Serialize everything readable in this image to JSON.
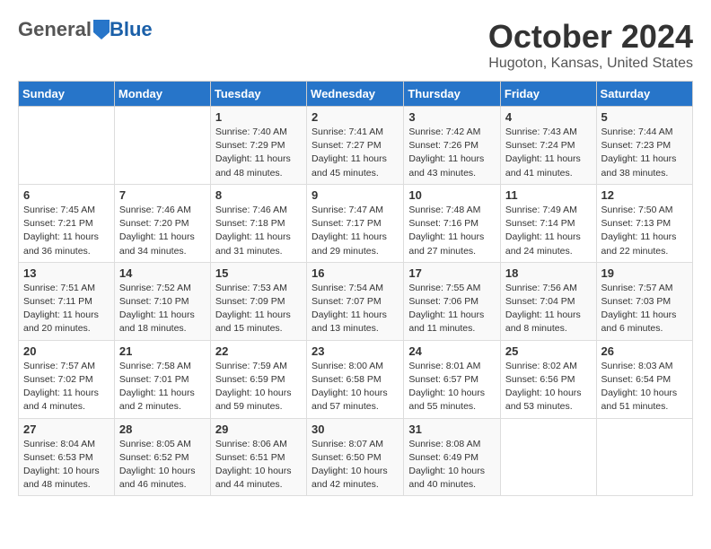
{
  "header": {
    "logo_general": "General",
    "logo_blue": "Blue",
    "month": "October 2024",
    "location": "Hugoton, Kansas, United States"
  },
  "days_of_week": [
    "Sunday",
    "Monday",
    "Tuesday",
    "Wednesday",
    "Thursday",
    "Friday",
    "Saturday"
  ],
  "weeks": [
    [
      {
        "day": "",
        "sunrise": "",
        "sunset": "",
        "daylight": ""
      },
      {
        "day": "",
        "sunrise": "",
        "sunset": "",
        "daylight": ""
      },
      {
        "day": "1",
        "sunrise": "Sunrise: 7:40 AM",
        "sunset": "Sunset: 7:29 PM",
        "daylight": "Daylight: 11 hours and 48 minutes."
      },
      {
        "day": "2",
        "sunrise": "Sunrise: 7:41 AM",
        "sunset": "Sunset: 7:27 PM",
        "daylight": "Daylight: 11 hours and 45 minutes."
      },
      {
        "day": "3",
        "sunrise": "Sunrise: 7:42 AM",
        "sunset": "Sunset: 7:26 PM",
        "daylight": "Daylight: 11 hours and 43 minutes."
      },
      {
        "day": "4",
        "sunrise": "Sunrise: 7:43 AM",
        "sunset": "Sunset: 7:24 PM",
        "daylight": "Daylight: 11 hours and 41 minutes."
      },
      {
        "day": "5",
        "sunrise": "Sunrise: 7:44 AM",
        "sunset": "Sunset: 7:23 PM",
        "daylight": "Daylight: 11 hours and 38 minutes."
      }
    ],
    [
      {
        "day": "6",
        "sunrise": "Sunrise: 7:45 AM",
        "sunset": "Sunset: 7:21 PM",
        "daylight": "Daylight: 11 hours and 36 minutes."
      },
      {
        "day": "7",
        "sunrise": "Sunrise: 7:46 AM",
        "sunset": "Sunset: 7:20 PM",
        "daylight": "Daylight: 11 hours and 34 minutes."
      },
      {
        "day": "8",
        "sunrise": "Sunrise: 7:46 AM",
        "sunset": "Sunset: 7:18 PM",
        "daylight": "Daylight: 11 hours and 31 minutes."
      },
      {
        "day": "9",
        "sunrise": "Sunrise: 7:47 AM",
        "sunset": "Sunset: 7:17 PM",
        "daylight": "Daylight: 11 hours and 29 minutes."
      },
      {
        "day": "10",
        "sunrise": "Sunrise: 7:48 AM",
        "sunset": "Sunset: 7:16 PM",
        "daylight": "Daylight: 11 hours and 27 minutes."
      },
      {
        "day": "11",
        "sunrise": "Sunrise: 7:49 AM",
        "sunset": "Sunset: 7:14 PM",
        "daylight": "Daylight: 11 hours and 24 minutes."
      },
      {
        "day": "12",
        "sunrise": "Sunrise: 7:50 AM",
        "sunset": "Sunset: 7:13 PM",
        "daylight": "Daylight: 11 hours and 22 minutes."
      }
    ],
    [
      {
        "day": "13",
        "sunrise": "Sunrise: 7:51 AM",
        "sunset": "Sunset: 7:11 PM",
        "daylight": "Daylight: 11 hours and 20 minutes."
      },
      {
        "day": "14",
        "sunrise": "Sunrise: 7:52 AM",
        "sunset": "Sunset: 7:10 PM",
        "daylight": "Daylight: 11 hours and 18 minutes."
      },
      {
        "day": "15",
        "sunrise": "Sunrise: 7:53 AM",
        "sunset": "Sunset: 7:09 PM",
        "daylight": "Daylight: 11 hours and 15 minutes."
      },
      {
        "day": "16",
        "sunrise": "Sunrise: 7:54 AM",
        "sunset": "Sunset: 7:07 PM",
        "daylight": "Daylight: 11 hours and 13 minutes."
      },
      {
        "day": "17",
        "sunrise": "Sunrise: 7:55 AM",
        "sunset": "Sunset: 7:06 PM",
        "daylight": "Daylight: 11 hours and 11 minutes."
      },
      {
        "day": "18",
        "sunrise": "Sunrise: 7:56 AM",
        "sunset": "Sunset: 7:04 PM",
        "daylight": "Daylight: 11 hours and 8 minutes."
      },
      {
        "day": "19",
        "sunrise": "Sunrise: 7:57 AM",
        "sunset": "Sunset: 7:03 PM",
        "daylight": "Daylight: 11 hours and 6 minutes."
      }
    ],
    [
      {
        "day": "20",
        "sunrise": "Sunrise: 7:57 AM",
        "sunset": "Sunset: 7:02 PM",
        "daylight": "Daylight: 11 hours and 4 minutes."
      },
      {
        "day": "21",
        "sunrise": "Sunrise: 7:58 AM",
        "sunset": "Sunset: 7:01 PM",
        "daylight": "Daylight: 11 hours and 2 minutes."
      },
      {
        "day": "22",
        "sunrise": "Sunrise: 7:59 AM",
        "sunset": "Sunset: 6:59 PM",
        "daylight": "Daylight: 10 hours and 59 minutes."
      },
      {
        "day": "23",
        "sunrise": "Sunrise: 8:00 AM",
        "sunset": "Sunset: 6:58 PM",
        "daylight": "Daylight: 10 hours and 57 minutes."
      },
      {
        "day": "24",
        "sunrise": "Sunrise: 8:01 AM",
        "sunset": "Sunset: 6:57 PM",
        "daylight": "Daylight: 10 hours and 55 minutes."
      },
      {
        "day": "25",
        "sunrise": "Sunrise: 8:02 AM",
        "sunset": "Sunset: 6:56 PM",
        "daylight": "Daylight: 10 hours and 53 minutes."
      },
      {
        "day": "26",
        "sunrise": "Sunrise: 8:03 AM",
        "sunset": "Sunset: 6:54 PM",
        "daylight": "Daylight: 10 hours and 51 minutes."
      }
    ],
    [
      {
        "day": "27",
        "sunrise": "Sunrise: 8:04 AM",
        "sunset": "Sunset: 6:53 PM",
        "daylight": "Daylight: 10 hours and 48 minutes."
      },
      {
        "day": "28",
        "sunrise": "Sunrise: 8:05 AM",
        "sunset": "Sunset: 6:52 PM",
        "daylight": "Daylight: 10 hours and 46 minutes."
      },
      {
        "day": "29",
        "sunrise": "Sunrise: 8:06 AM",
        "sunset": "Sunset: 6:51 PM",
        "daylight": "Daylight: 10 hours and 44 minutes."
      },
      {
        "day": "30",
        "sunrise": "Sunrise: 8:07 AM",
        "sunset": "Sunset: 6:50 PM",
        "daylight": "Daylight: 10 hours and 42 minutes."
      },
      {
        "day": "31",
        "sunrise": "Sunrise: 8:08 AM",
        "sunset": "Sunset: 6:49 PM",
        "daylight": "Daylight: 10 hours and 40 minutes."
      },
      {
        "day": "",
        "sunrise": "",
        "sunset": "",
        "daylight": ""
      },
      {
        "day": "",
        "sunrise": "",
        "sunset": "",
        "daylight": ""
      }
    ]
  ]
}
